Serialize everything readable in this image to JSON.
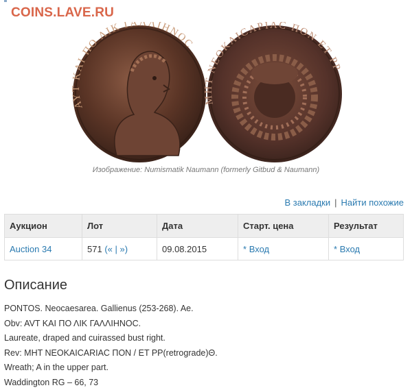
{
  "site": {
    "watermark": "COINS.LAVE.RU"
  },
  "image": {
    "caption": "Изображение: Numismatik Naumann (formerly Gitbud & Naumann)",
    "obverse_legend": "ΑΥΤ ΚΑΙ ΠΟ ΛΙΚ ΓΑΛΛΙΗΝΟC",
    "reverse_legend": "ΜΗΤ ΝΕΟΚΑΙCΑΡΙΑC ΠΟΝ ΕΤ ΡΡ"
  },
  "actions": {
    "bookmark_label": "В закладки",
    "separator": "|",
    "similar_label": "Найти похожие"
  },
  "table": {
    "headers": [
      "Аукцион",
      "Лот",
      "Дата",
      "Старт. цена",
      "Результат"
    ],
    "row": {
      "auction": "Auction 34",
      "lot_number": "571",
      "lot_open": "(",
      "lot_prev": "«",
      "lot_sep": "|",
      "lot_next": "»",
      "lot_close": ")",
      "date": "09.08.2015",
      "start_prefix": "*",
      "start_link": "Вход",
      "result_prefix": "*",
      "result_link": "Вход"
    }
  },
  "description": {
    "title": "Описание",
    "lines": [
      "PONTOS. Neocaesarea. Gallienus (253-268). Ae.",
      "Obv: AVT KAI ΠΟ ΛΙΚ ΓΑΛΛΙΗΝΟC.",
      "Laureate, draped and cuirassed bust right.",
      "Rev: MHT NEOKAICARIAC ΠΟΝ / ET PP(retrograde)Θ.",
      "Wreath; A in the upper part.",
      "Waddington RG – 66, 73"
    ]
  }
}
